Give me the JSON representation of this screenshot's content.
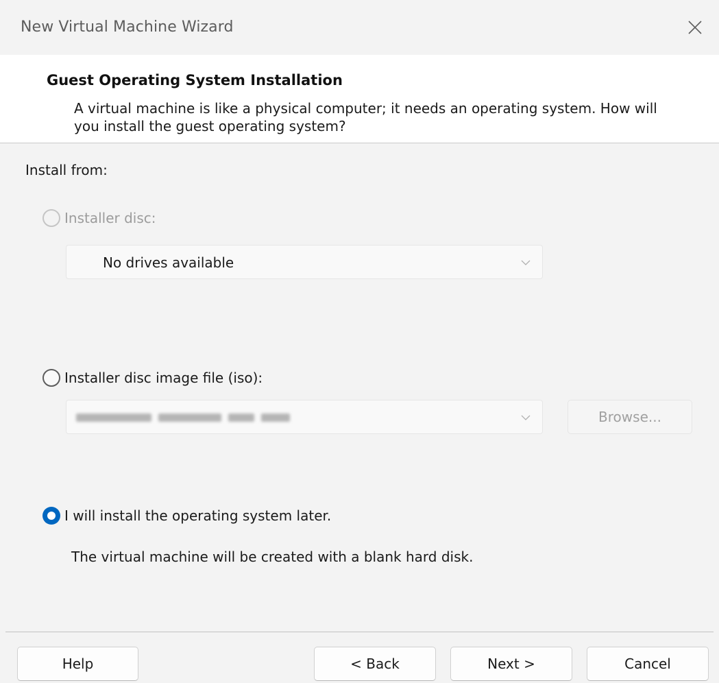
{
  "window": {
    "title": "New Virtual Machine Wizard",
    "close_icon": "close-icon"
  },
  "header": {
    "title": "Guest Operating System Installation",
    "description": "A virtual machine is like a physical computer; it needs an operating system. How will you install the guest operating system?"
  },
  "install_from": {
    "label": "Install from:",
    "options": [
      {
        "label": "Installer disc:",
        "selected": false,
        "enabled": false,
        "dropdown_value": "No drives available"
      },
      {
        "label": "Installer disc image file (iso):",
        "selected": false,
        "enabled": true,
        "browse_label": "Browse..."
      },
      {
        "label": "I will install the operating system later.",
        "selected": true,
        "enabled": true,
        "note": "The virtual machine will be created with a blank hard disk."
      }
    ]
  },
  "footer": {
    "help_label": "Help",
    "back_label": "< Back",
    "next_label": "Next >",
    "cancel_label": "Cancel"
  },
  "colors": {
    "accent": "#0067c0",
    "window_bg": "#f3f3f3",
    "header_bg": "#ffffff",
    "disabled_text": "#9c9c9c"
  }
}
